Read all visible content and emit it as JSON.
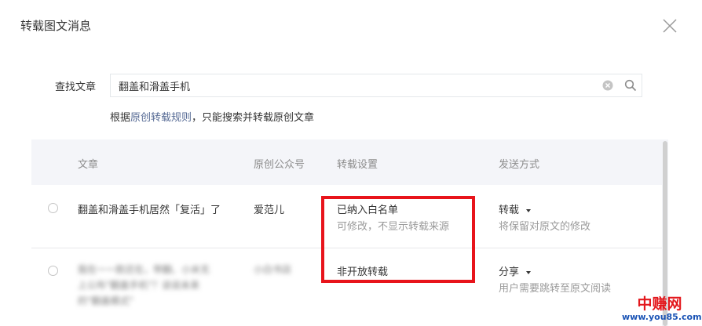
{
  "dialog": {
    "title": "转载图文消息"
  },
  "search": {
    "label": "查找文章",
    "value": "翻盖和滑盖手机",
    "hint_prefix": "根据",
    "hint_link": "原创转载规则",
    "hint_suffix": "，只能搜索并转载原创文章"
  },
  "table": {
    "headers": [
      "文章",
      "原创公众号",
      "转载设置",
      "发送方式"
    ],
    "rows": [
      {
        "article": "翻盖和滑盖手机居然「复活」了",
        "account": "爱范儿",
        "setting": "已纳入白名单",
        "setting_sub": "可修改，不显示转载来源",
        "send_mode": "转载",
        "send_sub": "将保留对原文的修改"
      },
      {
        "article_lines": [
          "我在一一款还在，带翻、小米无",
          "上公布\"翻盖手机\"？谈说未来",
          "的\"翻盖模式\""
        ],
        "account": "小白书店",
        "setting": "非开放转载",
        "send_mode": "分享",
        "send_sub": "用户需要跳转至原文阅读"
      }
    ]
  },
  "watermark": {
    "title": "中赚网",
    "url": "www.you85.com"
  },
  "colors": {
    "link": "#576b95",
    "highlight_box": "#e8141b",
    "header_bg": "#f4f5f9"
  }
}
